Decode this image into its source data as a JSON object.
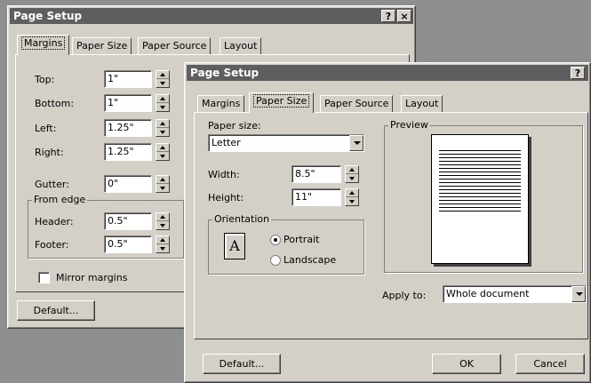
{
  "back_dialog": {
    "title": "Page Setup",
    "tabs": [
      {
        "label": "Margins"
      },
      {
        "label": "Paper Size"
      },
      {
        "label": "Paper Source"
      },
      {
        "label": "Layout"
      }
    ],
    "fields": {
      "top": {
        "label": "Top:",
        "value": "1\""
      },
      "bottom": {
        "label": "Bottom:",
        "value": "1\""
      },
      "left": {
        "label": "Left:",
        "value": "1.25\""
      },
      "right": {
        "label": "Right:",
        "value": "1.25\""
      },
      "gutter": {
        "label": "Gutter:",
        "value": "0\""
      }
    },
    "from_edge": {
      "title": "From edge",
      "header": {
        "label": "Header:",
        "value": "0.5\""
      },
      "footer": {
        "label": "Footer:",
        "value": "0.5\""
      }
    },
    "mirror_margins": "Mirror margins",
    "default_button": "Default..."
  },
  "front_dialog": {
    "title": "Page Setup",
    "tabs": [
      {
        "label": "Margins"
      },
      {
        "label": "Paper Size"
      },
      {
        "label": "Paper Source"
      },
      {
        "label": "Layout"
      }
    ],
    "paper_size": {
      "label": "Paper size:",
      "value": "Letter"
    },
    "width": {
      "label": "Width:",
      "value": "8.5\""
    },
    "height": {
      "label": "Height:",
      "value": "11\""
    },
    "orientation": {
      "title": "Orientation",
      "icon_letter": "A",
      "portrait": "Portrait",
      "landscape": "Landscape",
      "selected": "Portrait"
    },
    "preview": {
      "title": "Preview"
    },
    "apply_to": {
      "label": "Apply to:",
      "value": "Whole document"
    },
    "default_button": "Default...",
    "ok_button": "OK",
    "cancel_button": "Cancel"
  },
  "titlebar_buttons": {
    "help": "?",
    "close": "×"
  }
}
